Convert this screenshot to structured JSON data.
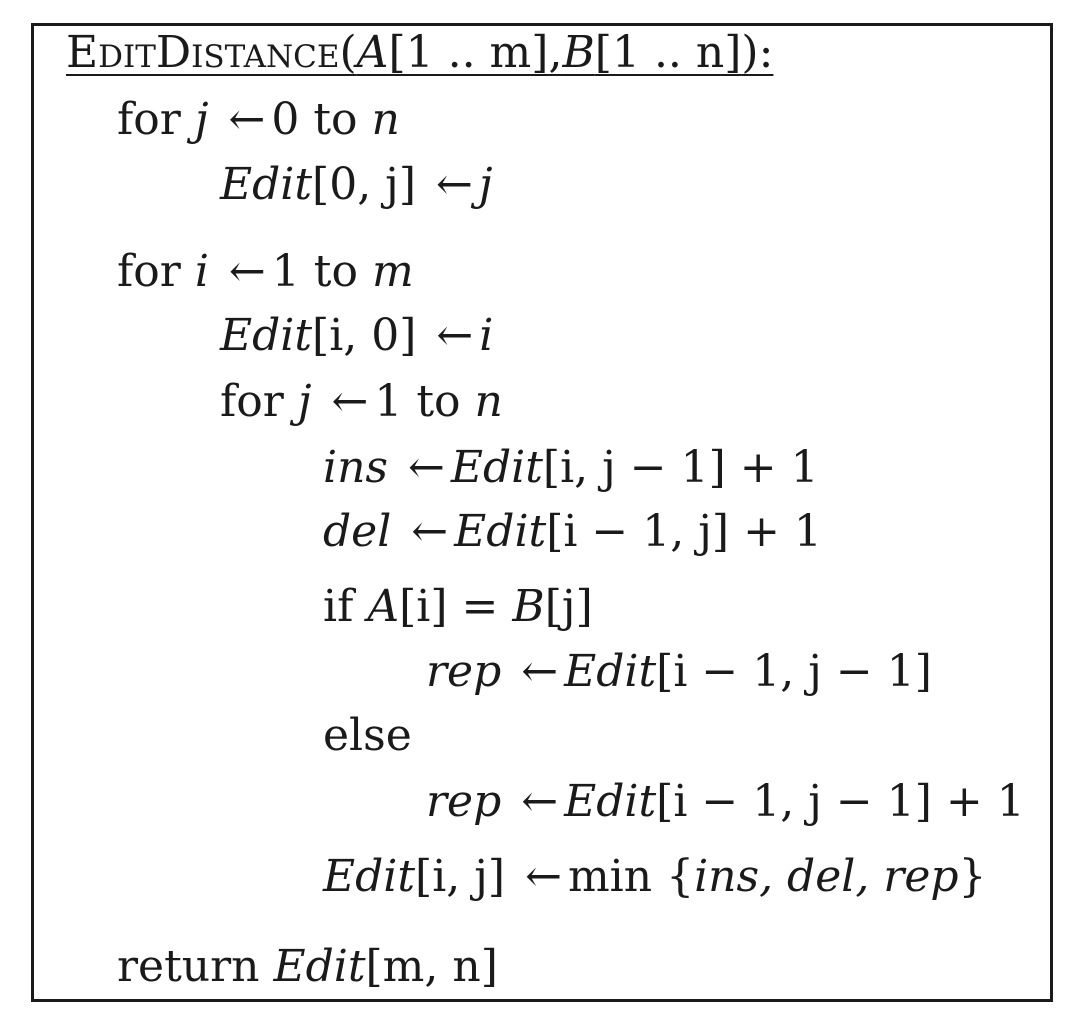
{
  "algorithm": {
    "name": "EditDistance",
    "signature": {
      "open": "(",
      "a_name": "A",
      "a_range": "[1 .. m]",
      "comma": ",",
      "b_name": "B",
      "b_range": "[1 .. n]",
      "close": "):"
    },
    "lines": {
      "l1": {
        "kw": "for",
        "var": "j",
        "arrow": "←",
        "start": "0",
        "to": "to",
        "end": "n"
      },
      "l2": {
        "lhs": "Edit",
        "idx": "[0, j]",
        "arrow": "←",
        "rhs": "j"
      },
      "l3": {
        "kw": "for",
        "var": "i",
        "arrow": "←",
        "start": "1",
        "to": "to",
        "end": "m"
      },
      "l4": {
        "lhs": "Edit",
        "idx": "[i, 0]",
        "arrow": "←",
        "rhs": "i"
      },
      "l5": {
        "kw": "for",
        "var": "j",
        "arrow": "←",
        "start": "1",
        "to": "to",
        "end": "n"
      },
      "l6": {
        "lhs": "ins",
        "arrow": "←",
        "rhs": "Edit",
        "idx": "[i, j − 1]",
        "tail": "+ 1"
      },
      "l7": {
        "lhs": "del",
        "arrow": "←",
        "rhs": "Edit",
        "idx": "[i − 1, j]",
        "tail": "+ 1"
      },
      "l8": {
        "kw": "if",
        "cond_a": "A",
        "cond_a_idx": "[i]",
        "eq": "=",
        "cond_b": "B",
        "cond_b_idx": "[j]"
      },
      "l9": {
        "lhs": "rep",
        "arrow": "←",
        "rhs": "Edit",
        "idx": "[i − 1, j − 1]"
      },
      "l10": {
        "kw": "else"
      },
      "l11": {
        "lhs": "rep",
        "arrow": "←",
        "rhs": "Edit",
        "idx": "[i − 1, j − 1]",
        "tail": "+ 1"
      },
      "l12": {
        "lhs": "Edit",
        "idx": "[i, j]",
        "arrow": "←",
        "fn": "min",
        "args_open": "{",
        "args": "ins, del, rep",
        "args_close": "}"
      },
      "l13": {
        "kw": "return",
        "rhs": "Edit",
        "idx": "[m, n]"
      }
    }
  }
}
